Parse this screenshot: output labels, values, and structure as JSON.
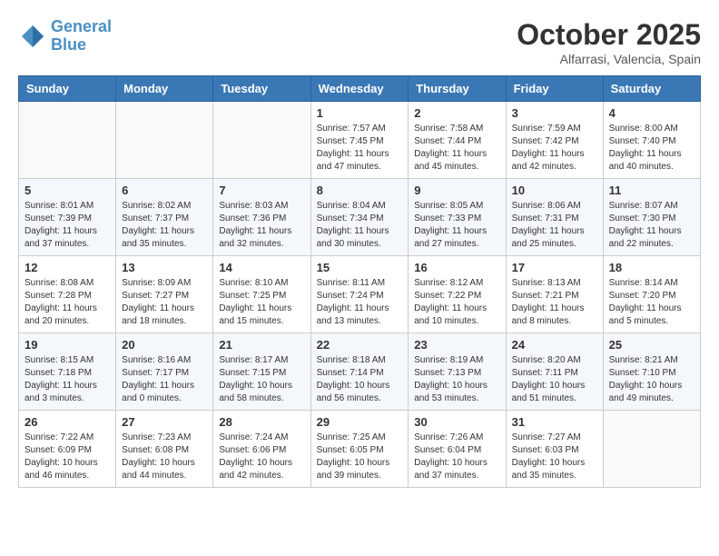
{
  "header": {
    "logo_line1": "General",
    "logo_line2": "Blue",
    "month_year": "October 2025",
    "location": "Alfarrasi, Valencia, Spain"
  },
  "weekdays": [
    "Sunday",
    "Monday",
    "Tuesday",
    "Wednesday",
    "Thursday",
    "Friday",
    "Saturday"
  ],
  "weeks": [
    [
      {
        "day": "",
        "info": ""
      },
      {
        "day": "",
        "info": ""
      },
      {
        "day": "",
        "info": ""
      },
      {
        "day": "1",
        "info": "Sunrise: 7:57 AM\nSunset: 7:45 PM\nDaylight: 11 hours\nand 47 minutes."
      },
      {
        "day": "2",
        "info": "Sunrise: 7:58 AM\nSunset: 7:44 PM\nDaylight: 11 hours\nand 45 minutes."
      },
      {
        "day": "3",
        "info": "Sunrise: 7:59 AM\nSunset: 7:42 PM\nDaylight: 11 hours\nand 42 minutes."
      },
      {
        "day": "4",
        "info": "Sunrise: 8:00 AM\nSunset: 7:40 PM\nDaylight: 11 hours\nand 40 minutes."
      }
    ],
    [
      {
        "day": "5",
        "info": "Sunrise: 8:01 AM\nSunset: 7:39 PM\nDaylight: 11 hours\nand 37 minutes."
      },
      {
        "day": "6",
        "info": "Sunrise: 8:02 AM\nSunset: 7:37 PM\nDaylight: 11 hours\nand 35 minutes."
      },
      {
        "day": "7",
        "info": "Sunrise: 8:03 AM\nSunset: 7:36 PM\nDaylight: 11 hours\nand 32 minutes."
      },
      {
        "day": "8",
        "info": "Sunrise: 8:04 AM\nSunset: 7:34 PM\nDaylight: 11 hours\nand 30 minutes."
      },
      {
        "day": "9",
        "info": "Sunrise: 8:05 AM\nSunset: 7:33 PM\nDaylight: 11 hours\nand 27 minutes."
      },
      {
        "day": "10",
        "info": "Sunrise: 8:06 AM\nSunset: 7:31 PM\nDaylight: 11 hours\nand 25 minutes."
      },
      {
        "day": "11",
        "info": "Sunrise: 8:07 AM\nSunset: 7:30 PM\nDaylight: 11 hours\nand 22 minutes."
      }
    ],
    [
      {
        "day": "12",
        "info": "Sunrise: 8:08 AM\nSunset: 7:28 PM\nDaylight: 11 hours\nand 20 minutes."
      },
      {
        "day": "13",
        "info": "Sunrise: 8:09 AM\nSunset: 7:27 PM\nDaylight: 11 hours\nand 18 minutes."
      },
      {
        "day": "14",
        "info": "Sunrise: 8:10 AM\nSunset: 7:25 PM\nDaylight: 11 hours\nand 15 minutes."
      },
      {
        "day": "15",
        "info": "Sunrise: 8:11 AM\nSunset: 7:24 PM\nDaylight: 11 hours\nand 13 minutes."
      },
      {
        "day": "16",
        "info": "Sunrise: 8:12 AM\nSunset: 7:22 PM\nDaylight: 11 hours\nand 10 minutes."
      },
      {
        "day": "17",
        "info": "Sunrise: 8:13 AM\nSunset: 7:21 PM\nDaylight: 11 hours\nand 8 minutes."
      },
      {
        "day": "18",
        "info": "Sunrise: 8:14 AM\nSunset: 7:20 PM\nDaylight: 11 hours\nand 5 minutes."
      }
    ],
    [
      {
        "day": "19",
        "info": "Sunrise: 8:15 AM\nSunset: 7:18 PM\nDaylight: 11 hours\nand 3 minutes."
      },
      {
        "day": "20",
        "info": "Sunrise: 8:16 AM\nSunset: 7:17 PM\nDaylight: 11 hours\nand 0 minutes."
      },
      {
        "day": "21",
        "info": "Sunrise: 8:17 AM\nSunset: 7:15 PM\nDaylight: 10 hours\nand 58 minutes."
      },
      {
        "day": "22",
        "info": "Sunrise: 8:18 AM\nSunset: 7:14 PM\nDaylight: 10 hours\nand 56 minutes."
      },
      {
        "day": "23",
        "info": "Sunrise: 8:19 AM\nSunset: 7:13 PM\nDaylight: 10 hours\nand 53 minutes."
      },
      {
        "day": "24",
        "info": "Sunrise: 8:20 AM\nSunset: 7:11 PM\nDaylight: 10 hours\nand 51 minutes."
      },
      {
        "day": "25",
        "info": "Sunrise: 8:21 AM\nSunset: 7:10 PM\nDaylight: 10 hours\nand 49 minutes."
      }
    ],
    [
      {
        "day": "26",
        "info": "Sunrise: 7:22 AM\nSunset: 6:09 PM\nDaylight: 10 hours\nand 46 minutes."
      },
      {
        "day": "27",
        "info": "Sunrise: 7:23 AM\nSunset: 6:08 PM\nDaylight: 10 hours\nand 44 minutes."
      },
      {
        "day": "28",
        "info": "Sunrise: 7:24 AM\nSunset: 6:06 PM\nDaylight: 10 hours\nand 42 minutes."
      },
      {
        "day": "29",
        "info": "Sunrise: 7:25 AM\nSunset: 6:05 PM\nDaylight: 10 hours\nand 39 minutes."
      },
      {
        "day": "30",
        "info": "Sunrise: 7:26 AM\nSunset: 6:04 PM\nDaylight: 10 hours\nand 37 minutes."
      },
      {
        "day": "31",
        "info": "Sunrise: 7:27 AM\nSunset: 6:03 PM\nDaylight: 10 hours\nand 35 minutes."
      },
      {
        "day": "",
        "info": ""
      }
    ]
  ]
}
